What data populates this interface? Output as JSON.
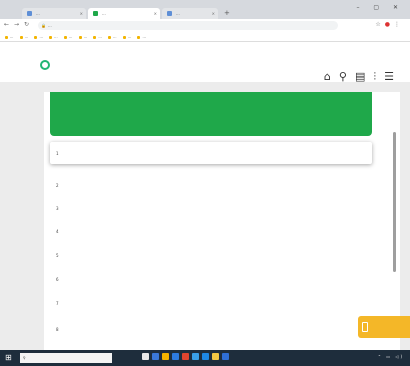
{
  "browser": {
    "tabs": [
      {
        "label": "...",
        "favicon_color": "#5f8fd6"
      },
      {
        "label": "...",
        "favicon_color": "#1fa84a"
      },
      {
        "label": "...",
        "favicon_color": "#5f8fd6"
      }
    ],
    "new_tab": "+",
    "window_controls": "– ▢ ✕",
    "url": "...",
    "bookmarks": [
      "...",
      "...",
      "...",
      "...",
      "...",
      "...",
      "...",
      "...",
      "...",
      "..."
    ]
  },
  "site": {
    "logo": "",
    "header_icons": [
      "home-icon",
      "location-icon",
      "document-icon",
      "chart-icon",
      "menu-icon"
    ]
  },
  "table": {
    "header_color": "#1fa84a",
    "headers": [
      "",
      "",
      "",
      ""
    ],
    "rows": [
      {
        "num": "1",
        "name": "",
        "c1": "",
        "c2": "",
        "c3": ""
      },
      {
        "num": "2",
        "name": "",
        "c1": "",
        "c2": "",
        "c3": ""
      },
      {
        "num": "3",
        "name": "",
        "c1": "",
        "c2": "",
        "c3": ""
      },
      {
        "num": "4",
        "name": "",
        "c1": "",
        "c2": "",
        "c3": ""
      },
      {
        "num": "5",
        "name": "",
        "c1": "",
        "c2": "",
        "c3": ""
      },
      {
        "num": "6",
        "name": "",
        "c1": "",
        "c2": "",
        "c3": ""
      },
      {
        "num": "7",
        "name": "",
        "c1": "",
        "c2": "",
        "c3": ""
      },
      {
        "num": "8",
        "name": "",
        "c1": "",
        "c2": "",
        "c3": ""
      }
    ]
  },
  "chat_widget": {
    "label": "",
    "color": "#f4b728"
  },
  "taskbar": {
    "search_placeholder": "",
    "apps": [
      "#e8e8e8",
      "#3b78d8",
      "#f5b400",
      "#2d7be0",
      "#e0452f",
      "#3aa0e8",
      "#1e88e5",
      "#f2c744",
      "#2f6fd6"
    ]
  }
}
